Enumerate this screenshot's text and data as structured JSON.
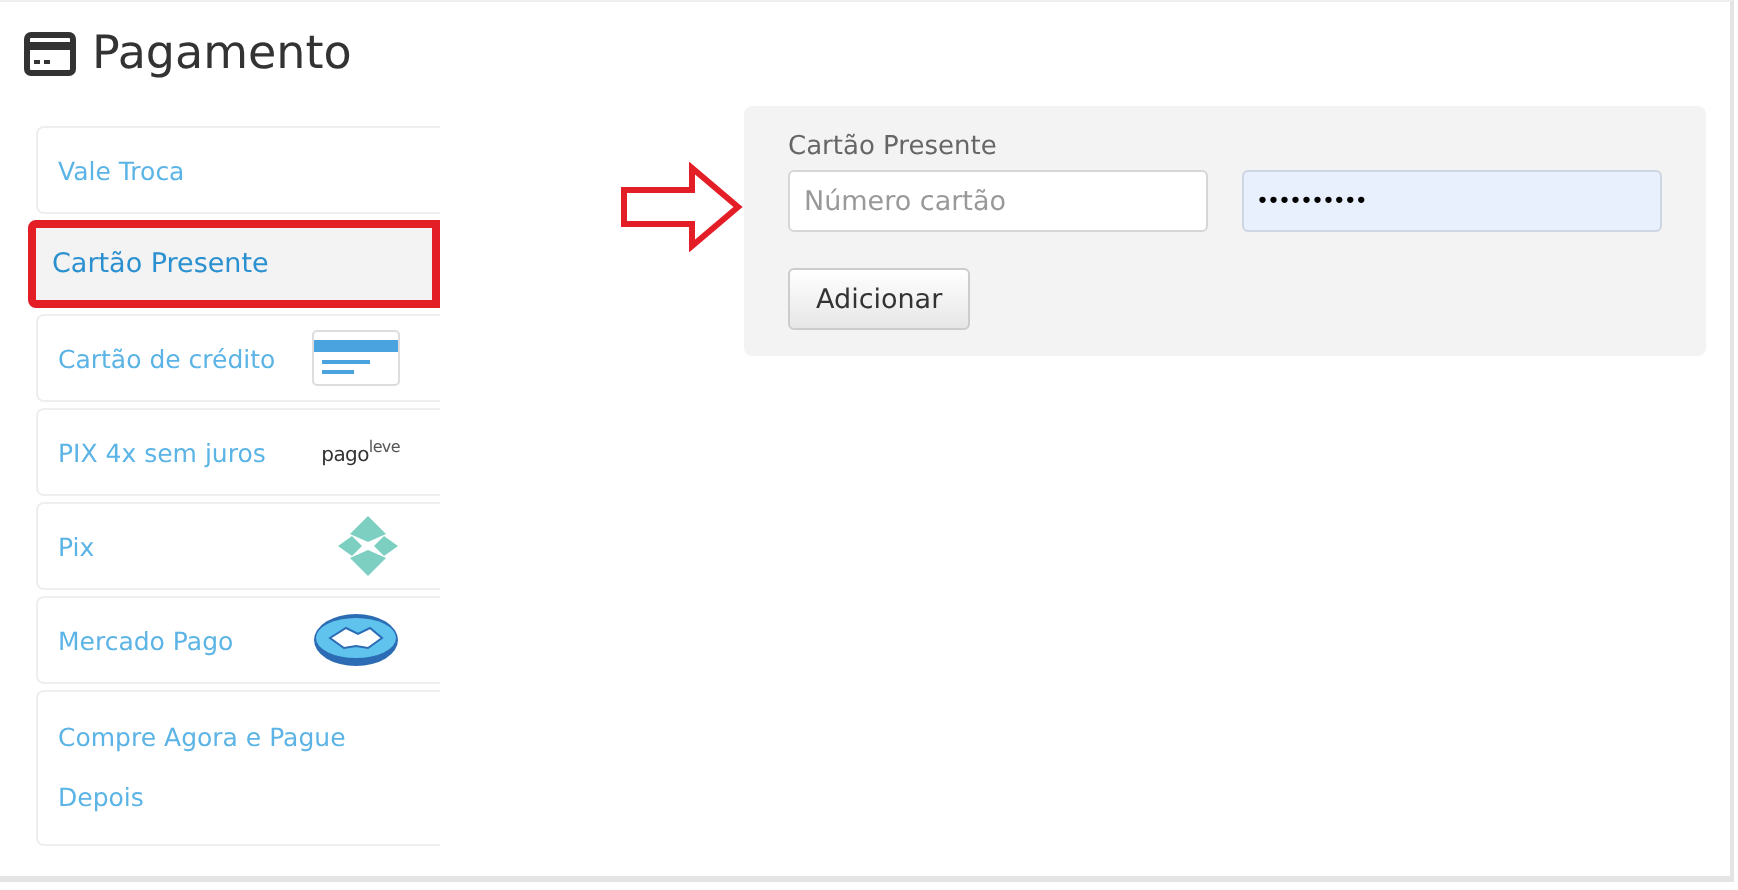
{
  "title": "Pagamento",
  "methods": [
    {
      "label": "Vale Troca",
      "selected": false,
      "kind": "plain"
    },
    {
      "label": "Cartão Presente",
      "selected": true,
      "kind": "plain"
    },
    {
      "label": "Cartão de crédito",
      "selected": false,
      "kind": "card"
    },
    {
      "label": "PIX 4x sem juros",
      "selected": false,
      "kind": "text_logo",
      "logo_text": "pago$^{leve}$"
    },
    {
      "label": "Pix",
      "selected": false,
      "kind": "pix"
    },
    {
      "label": "Mercado Pago",
      "selected": false,
      "kind": "handshake"
    },
    {
      "label": "Compre Agora e Pague Depois",
      "selected": false,
      "kind": "plain"
    }
  ],
  "form": {
    "label": "Cartão Presente",
    "card_number": {
      "placeholder": "Número cartão"
    },
    "pin": {
      "value": "••••••••••"
    },
    "button": "Adicionar"
  }
}
